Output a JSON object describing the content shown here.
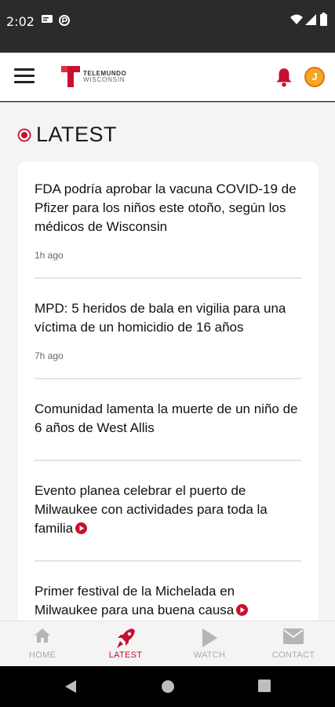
{
  "status_bar": {
    "time": "2:02",
    "icons": [
      "cast-icon",
      "data-saver-icon",
      "wifi-icon",
      "signal-icon",
      "battery-icon"
    ]
  },
  "header": {
    "logo_line1": "TELEMUNDO",
    "logo_line2": "WISCONSIN",
    "avatar_initial": "J",
    "accent_color": "#c8102e"
  },
  "section": {
    "title": "LATEST"
  },
  "articles": [
    {
      "headline": "FDA podría aprobar la vacuna COVID-19 de Pfizer para los niños este otoño, según los médicos de Wisconsin",
      "time_ago": "1h ago",
      "has_video": false
    },
    {
      "headline": "MPD: 5 heridos de bala en vigilia para una víctima de un homicidio de 16 años",
      "time_ago": "7h ago",
      "has_video": false
    },
    {
      "headline": "Comunidad lamenta la muerte de un niño de 6 años de West Allis",
      "time_ago": "",
      "has_video": false
    },
    {
      "headline": "Evento planea celebrar el puerto de Milwaukee con actividades para toda la familia",
      "time_ago": "",
      "has_video": true
    },
    {
      "headline": "Primer festival de la Michelada en Milwaukee para una buena causa",
      "time_ago": "",
      "has_video": true
    }
  ],
  "bottom_nav": [
    {
      "label": "HOME",
      "icon": "home-icon",
      "active": false
    },
    {
      "label": "LATEST",
      "icon": "rocket-icon",
      "active": true
    },
    {
      "label": "WATCH",
      "icon": "play-icon",
      "active": false
    },
    {
      "label": "CONTACT",
      "icon": "mail-icon",
      "active": false
    }
  ]
}
